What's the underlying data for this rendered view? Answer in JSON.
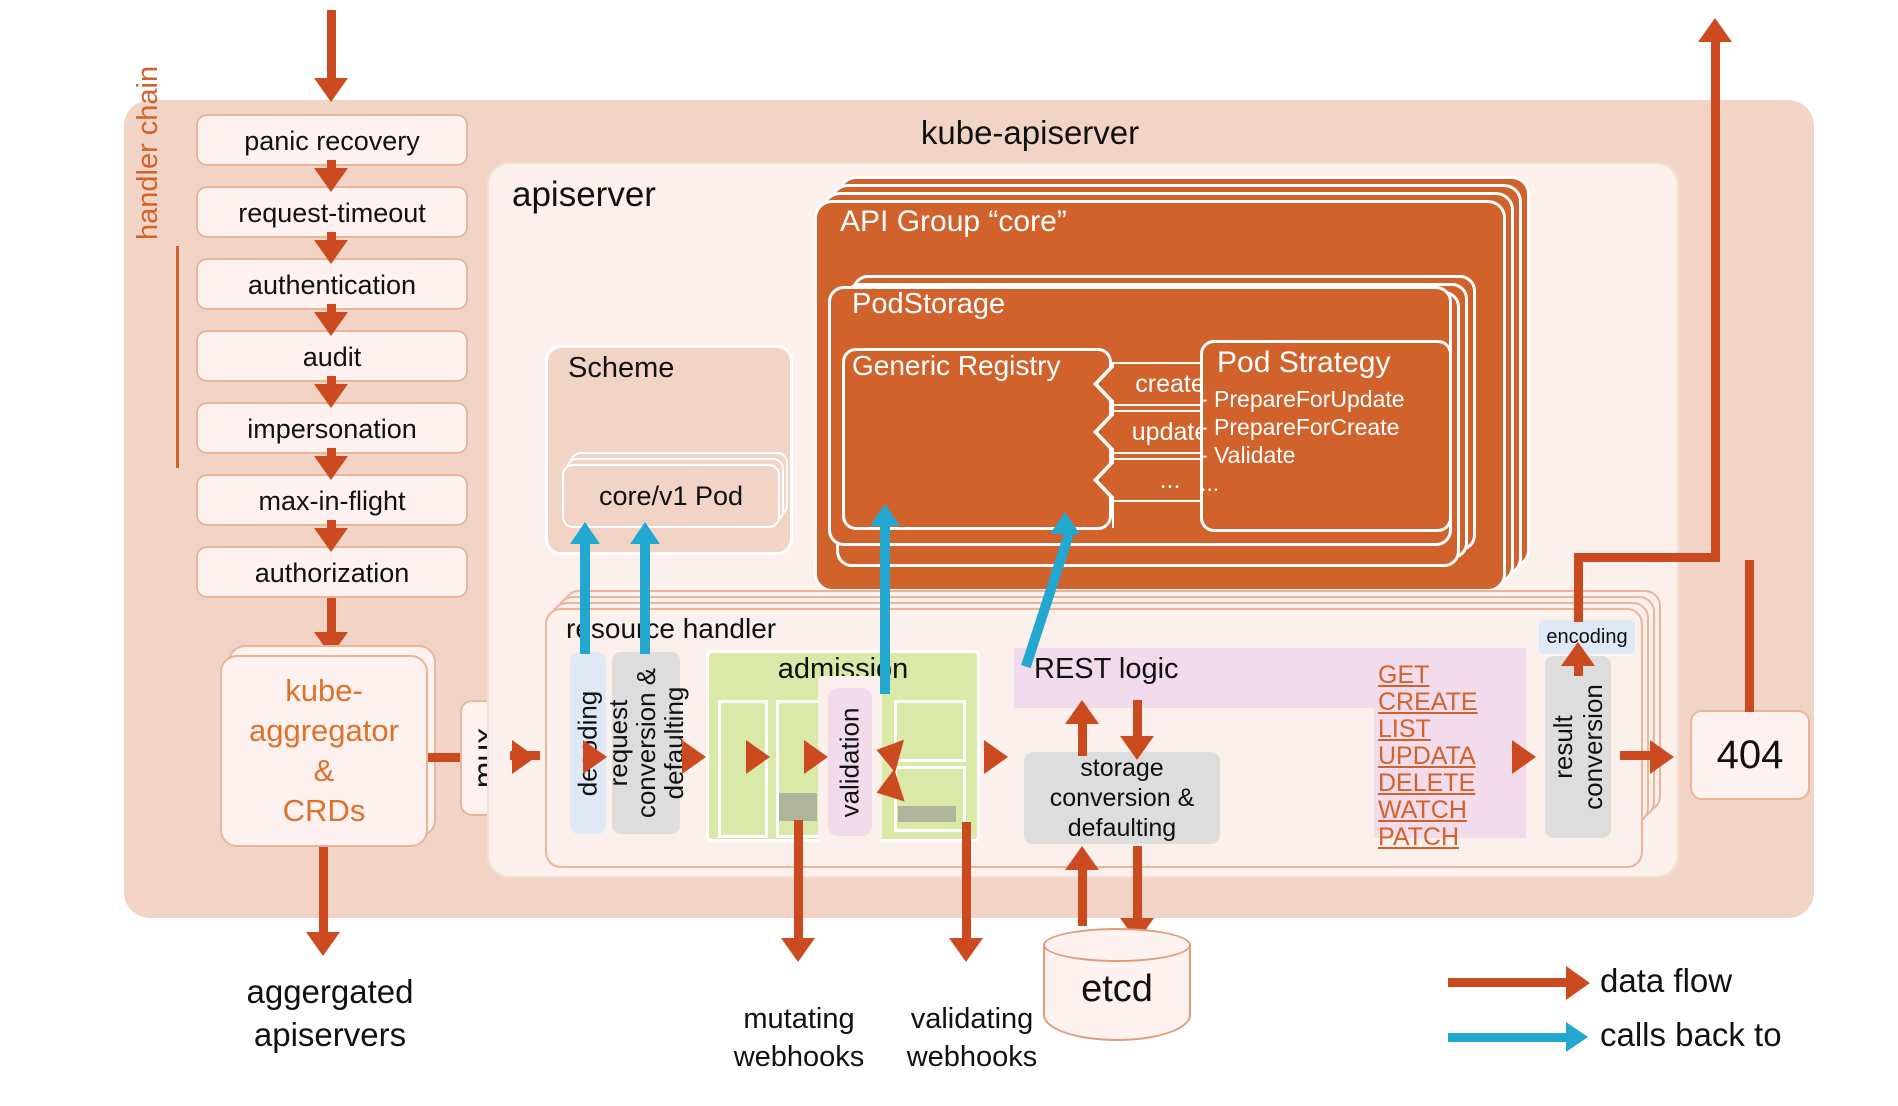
{
  "diagram": {
    "title": "kube-apiserver",
    "apiserver_label": "apiserver",
    "handler_chain_label": "handler chain"
  },
  "handler_chain": {
    "items": [
      {
        "label": "panic recovery"
      },
      {
        "label": "request-timeout"
      },
      {
        "label": "authentication"
      },
      {
        "label": "audit"
      },
      {
        "label": "impersonation"
      },
      {
        "label": "max-in-flight"
      },
      {
        "label": "authorization"
      }
    ],
    "aggregator": {
      "line1": "kube-",
      "line2": "aggregator",
      "line3": "&",
      "line4": "CRDs"
    },
    "mux_label": "mux",
    "aggregated_apiservers": {
      "line1": "aggergated",
      "line2": "apiservers"
    }
  },
  "scheme": {
    "title": "Scheme",
    "card_label": "core/v1 Pod"
  },
  "api_group": {
    "title": "API Group  “core”",
    "pod_storage": {
      "title": "PodStorage",
      "generic_registry": {
        "title": "Generic Registry",
        "verbs": [
          "create",
          "update",
          "..."
        ]
      },
      "pod_strategy": {
        "title": "Pod Strategy",
        "items": [
          "- PrepareForUpdate",
          "- PrepareForCreate",
          "- Validate",
          "..."
        ]
      }
    }
  },
  "resource_handler": {
    "title": "resource handler",
    "decoding_label": "decoding",
    "request_conversion_label": "request\nconversion &\ndefaulting",
    "request_conversion_l1": "request",
    "request_conversion_l2": "conversion &",
    "request_conversion_l3": "defaulting",
    "admission_label": "admission",
    "validation_label": "validation",
    "rest_logic_label": "REST logic",
    "storage_conversion_l1": "storage",
    "storage_conversion_l2": "conversion &",
    "storage_conversion_l3": "defaulting",
    "verbs": [
      "GET",
      "CREATE",
      "LIST",
      "UPDATA",
      "DELETE",
      "WATCH",
      "PATCH"
    ],
    "encoding_label": "encoding",
    "result_conversion_l1": "result",
    "result_conversion_l2": "conversion"
  },
  "external": {
    "not_found_label": "404",
    "mutating_webhooks_l1": "mutating",
    "mutating_webhooks_l2": "webhooks",
    "validating_webhooks_l1": "validating",
    "validating_webhooks_l2": "webhooks",
    "etcd_label": "etcd"
  },
  "legend": {
    "data_flow": "data flow",
    "calls_back_to": "calls back to"
  },
  "colors": {
    "data_flow_arrow": "#cc4a20",
    "calls_back_arrow": "#21a7d0",
    "api_group_fill": "#d2622c",
    "outer_fill": "#f2d4c6",
    "inner_fill": "#fcf0ec",
    "accent_text": "#d2622c",
    "admission_fill": "#dae8a8",
    "validation_fill": "#f2dbea",
    "decoding_fill": "#dfe9f5",
    "conversion_fill": "#dddddd"
  }
}
